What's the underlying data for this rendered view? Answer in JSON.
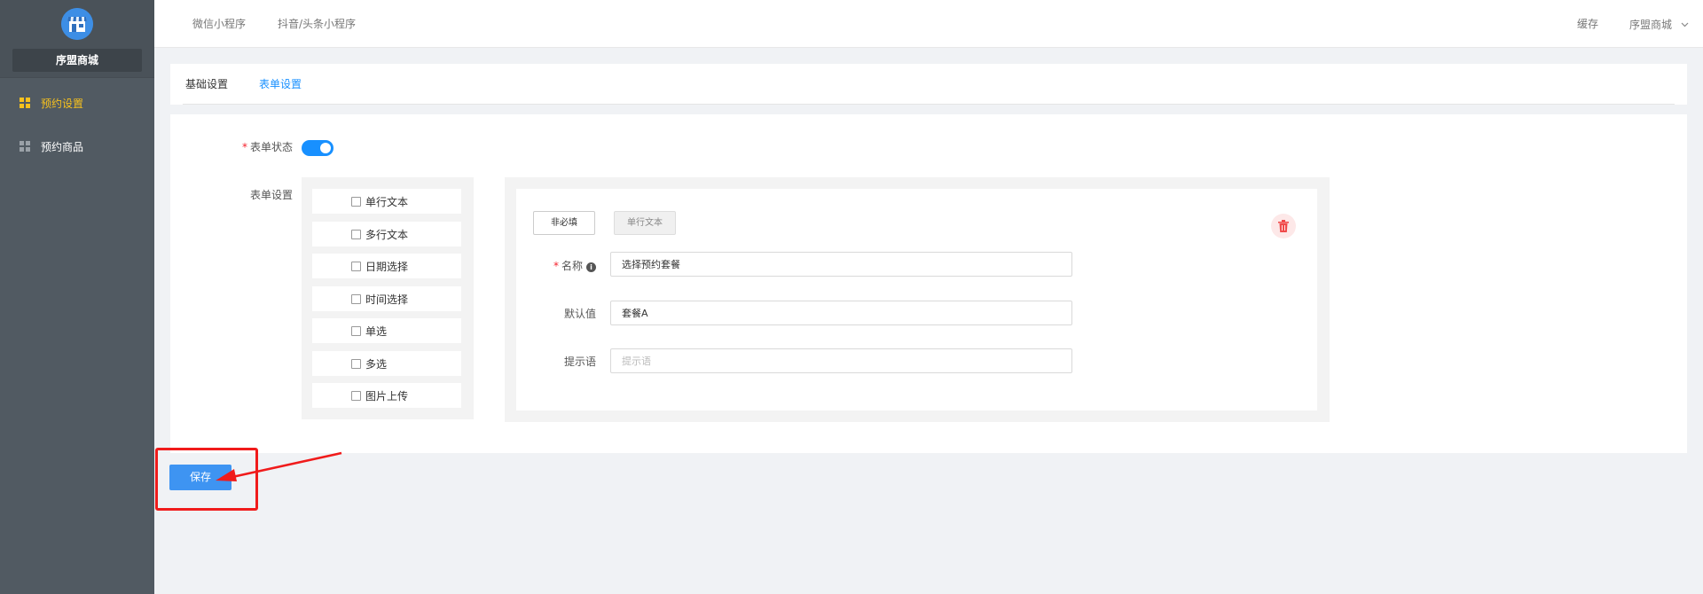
{
  "sidebar": {
    "shop_name": "序盟商城",
    "items": [
      {
        "label": "预约设置",
        "active": true
      },
      {
        "label": "预约商品",
        "active": false
      }
    ]
  },
  "topbar": {
    "tabs": [
      "微信小程序",
      "抖音/头条小程序"
    ],
    "cache_label": "缓存",
    "user_label": "序盟商城"
  },
  "inner_tabs": [
    {
      "label": "基础设置",
      "active": false
    },
    {
      "label": "表单设置",
      "active": true
    }
  ],
  "form": {
    "status_label": "表单状态",
    "status_on": true,
    "settings_label": "表单设置",
    "palette": [
      "单行文本",
      "多行文本",
      "日期选择",
      "时间选择",
      "单选",
      "多选",
      "图片上传"
    ],
    "editor": {
      "required_button": "非必填",
      "type_button": "单行文本",
      "name_label": "名称",
      "name_value": "选择预约套餐",
      "default_label": "默认值",
      "default_value": "套餐A",
      "hint_label": "提示语",
      "hint_placeholder": "提示语"
    }
  },
  "save_label": "保存",
  "colors": {
    "sidebar_bg": "#515a62",
    "active_nav": "#f7c11d",
    "primary": "#1890ff",
    "save_button": "#3e94f2",
    "annotation": "#f01b1b"
  }
}
